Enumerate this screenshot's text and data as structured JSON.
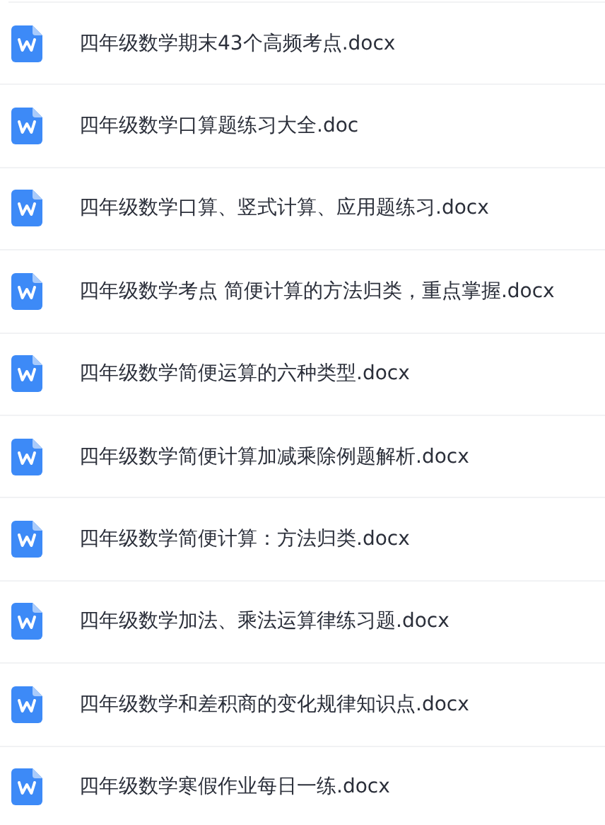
{
  "files": [
    {
      "name": "四年级数学期末43个高频考点.docx"
    },
    {
      "name": "四年级数学口算题练习大全.doc"
    },
    {
      "name": "四年级数学口算、竖式计算、应用题练习.docx"
    },
    {
      "name": "四年级数学考点 简便计算的方法归类，重点掌握.docx"
    },
    {
      "name": "四年级数学简便运算的六种类型.docx"
    },
    {
      "name": "四年级数学简便计算加减乘除例题解析.docx"
    },
    {
      "name": "四年级数学简便计算：方法归类.docx"
    },
    {
      "name": "四年级数学加法、乘法运算律练习题.docx"
    },
    {
      "name": "四年级数学和差积商的变化规律知识点.docx"
    },
    {
      "name": "四年级数学寒假作业每日一练.docx"
    }
  ]
}
